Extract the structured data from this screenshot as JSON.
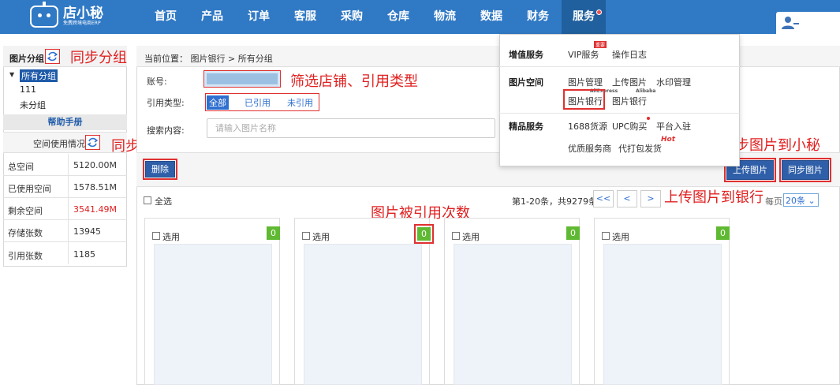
{
  "logo": {
    "brand": "店小秘",
    "tagline": "免费跨境电商ERP"
  },
  "nav": [
    "首页",
    "产品",
    "订单",
    "客服",
    "采购",
    "仓库",
    "物流",
    "数据",
    "财务",
    "服务"
  ],
  "sidebar": {
    "title": "图片分组",
    "tree": [
      "所有分组",
      "111",
      "未分组"
    ],
    "help": "帮助手册",
    "space_title": "空间使用情况",
    "stats": [
      {
        "label": "总空间",
        "value": "5120.00M"
      },
      {
        "label": "已使用空间",
        "value": "1578.51M"
      },
      {
        "label": "剩余空间",
        "value": "3541.49M"
      },
      {
        "label": "存储张数",
        "value": "13945"
      },
      {
        "label": "引用张数",
        "value": "1185"
      }
    ]
  },
  "main": {
    "breadcrumb": "当前位置：  图片银行 > 所有分组",
    "account_label": "账号:",
    "ref_type_label": "引用类型:",
    "ref_types": [
      "全部",
      "已引用",
      "未引用"
    ],
    "search_label": "搜索内容:",
    "search_placeholder": "请输入图片名称",
    "delete_btn": "删除",
    "upload_btn": "上传图片",
    "sync_btn": "同步图片",
    "select_all": "全选",
    "pager_info": "第1-20条，共9279条",
    "pager_buttons": [
      "<<",
      "<",
      ">"
    ],
    "per_page_label": "每页",
    "per_page_value": "20条 ⌄",
    "cards": [
      {
        "select": "选用",
        "count": "0"
      },
      {
        "select": "选用",
        "count": "0"
      },
      {
        "select": "选用",
        "count": "0"
      },
      {
        "select": "选用",
        "count": "0"
      }
    ]
  },
  "dropdown": {
    "sections": [
      {
        "title": "增值服务",
        "links": [
          "VIP服务",
          "操作日志"
        ],
        "tag": "重要"
      },
      {
        "title": "图片空间",
        "links": [
          "图片管理",
          "上传图片",
          "水印管理",
          "图片银行",
          "图片银行"
        ],
        "logos": [
          "AliExpress",
          "Alibaba"
        ]
      },
      {
        "title": "精品服务",
        "links": [
          "1688货源",
          "UPC购买",
          "平台入驻",
          "优质服务商",
          "代打包发货"
        ],
        "hot": "Hot"
      }
    ]
  },
  "annotations": {
    "sync_group": "同步分组",
    "sync_space": "同步图片空间使用情况",
    "filter": "筛选店铺、引用类型",
    "ref_count": "图片被引用次数",
    "sync_to_xiaomi": "同步图片到小秘",
    "upload_to_bank": "上传图片到银行"
  }
}
